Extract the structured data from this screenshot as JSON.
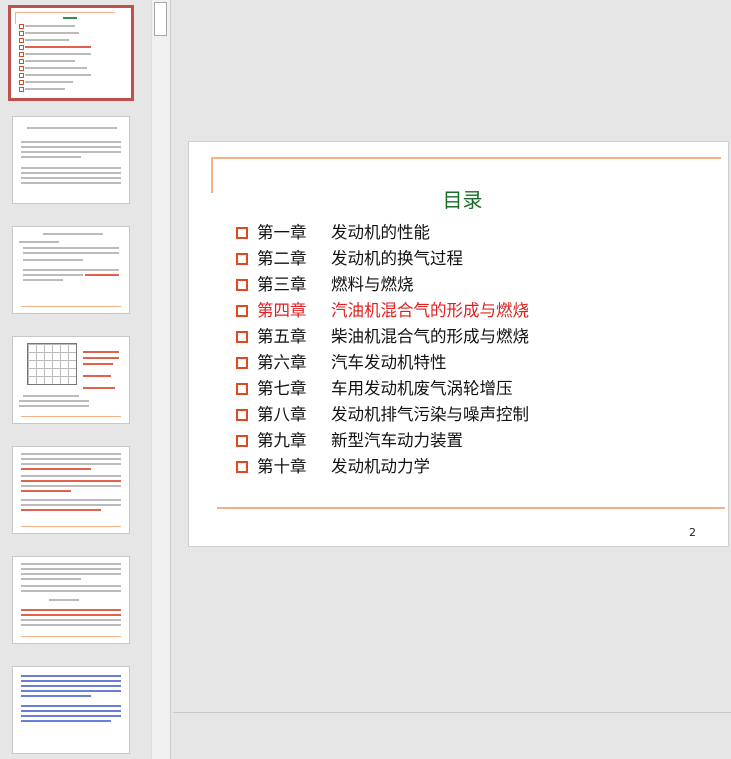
{
  "slide": {
    "title": "目录",
    "page_number": "2",
    "highlight_color": "#e02020",
    "title_color": "#1b6b2b",
    "bullet_color": "#e04a1c",
    "chapters": [
      {
        "chapter": "第一章",
        "topic": "发动机的性能"
      },
      {
        "chapter": "第二章",
        "topic": "发动机的换气过程"
      },
      {
        "chapter": "第三章",
        "topic": "燃料与燃烧"
      },
      {
        "chapter": "第四章",
        "topic": "汽油机混合气的形成与燃烧",
        "highlighted": true
      },
      {
        "chapter": "第五章",
        "topic": "柴油机混合气的形成与燃烧"
      },
      {
        "chapter": "第六章",
        "topic": "汽车发动机特性"
      },
      {
        "chapter": "第七章",
        "topic": "车用发动机废气涡轮增压"
      },
      {
        "chapter": "第八章",
        "topic": "发动机排气污染与噪声控制"
      },
      {
        "chapter": "第九章",
        "topic": "新型汽车动力装置"
      },
      {
        "chapter": "第十章",
        "topic": "发动机动力学"
      }
    ]
  }
}
